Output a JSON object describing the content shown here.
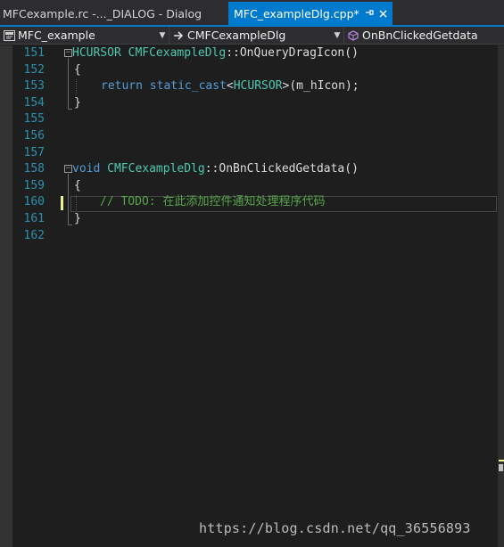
{
  "tabs": [
    {
      "title": "MFCexample.rc -..._DIALOG - Dialog",
      "active": false
    },
    {
      "title": "MFC_exampleDlg.cpp*",
      "active": true,
      "pin_icon": "pin-icon",
      "close_icon": "close-icon"
    }
  ],
  "navbar": {
    "project": {
      "label": "MFC_example",
      "icon": "project-icon"
    },
    "class": {
      "label": "CMFCexampleDlg",
      "icon": "class-icon"
    },
    "member": {
      "label": "OnBnClickedGetdata",
      "icon": "method-icon"
    }
  },
  "lines": [
    {
      "num": "151"
    },
    {
      "num": "152"
    },
    {
      "num": "153"
    },
    {
      "num": "154"
    },
    {
      "num": "155"
    },
    {
      "num": "156"
    },
    {
      "num": "157"
    },
    {
      "num": "158"
    },
    {
      "num": "159"
    },
    {
      "num": "160"
    },
    {
      "num": "161"
    },
    {
      "num": "162"
    }
  ],
  "code": {
    "l151_type": "HCURSOR",
    "l151_class": "CMFCexampleDlg",
    "l151_sep": "::",
    "l151_fn": "OnQueryDragIcon",
    "l151_paren": "()",
    "l152": "{",
    "l153_kw": "return",
    "l153_cast": "static_cast",
    "l153_lt": "<",
    "l153_type": "HCURSOR",
    "l153_rest": ">(m_hIcon);",
    "l154": "}",
    "l158_kw": "void",
    "l158_class": "CMFCexampleDlg",
    "l158_sep": "::",
    "l158_fn": "OnBnClickedGetdata",
    "l158_paren": "()",
    "l159": "{",
    "l160_comment": "// TODO: 在此添加控件通知处理程序代码",
    "l161": "}"
  },
  "watermark": "https://blog.csdn.net/qq_36556893",
  "colors": {
    "accent": "#007acc",
    "keyword": "#569cd6",
    "type": "#4ec9b0",
    "comment": "#57a64a",
    "line_number": "#2b91af",
    "change_marker": "#eff18c"
  }
}
